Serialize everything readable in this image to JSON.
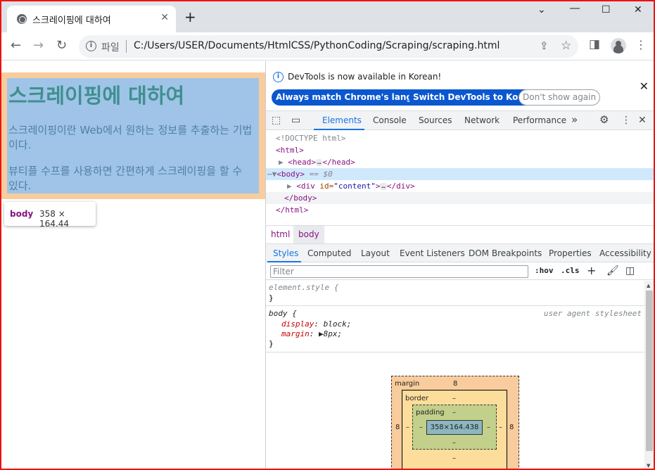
{
  "browser": {
    "tab_title": "스크레이핑에 대하여",
    "tab_close": "✕",
    "new_tab": "+",
    "win_min": "―",
    "win_max": "☐",
    "win_close": "✕",
    "win_dropdown": "⌄",
    "url_scheme": "파일",
    "url": "C:/Users/USER/Documents/HtmlCSS/PythonCoding/Scraping/scraping.html",
    "back": "←",
    "forward": "→",
    "reload": "↻",
    "share": "⇪",
    "star": "☆",
    "sidepanel": "◨",
    "menu": "⋮"
  },
  "page": {
    "heading": "스크레이핑에 대하여",
    "para1": "스크레이핑이란 Web에서 원하는 정보를 추출하는 기법이다.",
    "para2": "뷰티플 수프를 사용하면 간편하게 스크레이핑을 할 수 있다.",
    "tooltip_tag": "body",
    "tooltip_size": "358 × 164.44"
  },
  "devtools": {
    "banner_text": "DevTools is now available in Korean!",
    "btn_match": "Always match Chrome's language",
    "btn_switch": "Switch DevTools to Korean",
    "btn_dont": "Don't show again",
    "banner_close": "✕",
    "tabs": [
      "Elements",
      "Console",
      "Sources",
      "Network",
      "Performance"
    ],
    "more_tabs": "»",
    "dom": {
      "doctype": "<!DOCTYPE html>",
      "html_open": "<html>",
      "head_open": "<head>",
      "head_close": "</head>",
      "body_open": "<body>",
      "eq_dollar": "== $0",
      "div_tag_open": "<div ",
      "div_attr": "id=",
      "div_val": "\"content\"",
      "div_tag_end": ">",
      "div_close": "</div>",
      "body_close": "</body>",
      "html_close": "</html>"
    },
    "crumbs": [
      "html",
      "body"
    ],
    "subtabs": [
      "Styles",
      "Computed",
      "Layout",
      "Event Listeners",
      "DOM Breakpoints",
      "Properties",
      "Accessibility"
    ],
    "filter_placeholder": "Filter",
    "hov": ":hov",
    "cls": ".cls",
    "styles": {
      "element_style": "element.style {",
      "close1": "}",
      "body_selector": "body {",
      "ua": "user agent stylesheet",
      "display_prop": "display",
      "display_val": "block;",
      "margin_prop": "margin",
      "margin_val": "8px;",
      "close2": "}"
    },
    "boxmodel": {
      "margin_label": "margin",
      "margin_top": "8",
      "margin_left": "8",
      "margin_right": "8",
      "border_label": "border",
      "border_top": "–",
      "border_left": "–",
      "border_right": "–",
      "border_bottom": "–",
      "padding_label": "padding",
      "padding_top": "–",
      "padding_left": "–",
      "padding_right": "–",
      "padding_bottom": "–",
      "content_size": "358×164.438"
    }
  }
}
